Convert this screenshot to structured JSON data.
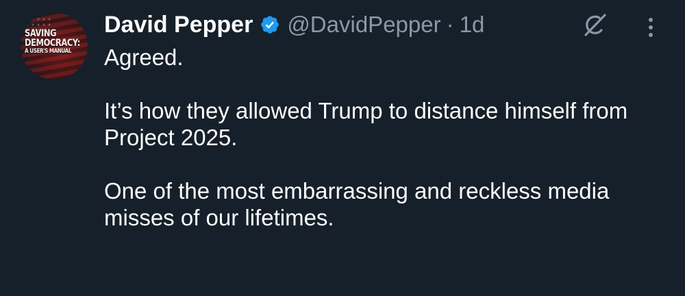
{
  "author": {
    "display_name": "David Pepper",
    "handle": "@DavidPepper",
    "separator": "·",
    "timestamp": "1d",
    "verified": true,
    "avatar_text": {
      "line1": "SAVING",
      "line2": "DEMOCRACY:",
      "line3": "A USER'S MANUAL"
    }
  },
  "icons": {
    "verified": "verified-badge-icon",
    "grok": "grok-icon",
    "more": "more-options-icon"
  },
  "tweet": {
    "paragraphs": [
      "Agreed.",
      "It’s how they allowed Trump to distance himself from Project 2025.",
      "One of the most embarrassing and reckless media misses of our lifetimes."
    ]
  },
  "colors": {
    "background": "#15202b",
    "text": "#ffffff",
    "secondary_text": "#8b98a5",
    "verified_blue": "#1d9bf0"
  }
}
